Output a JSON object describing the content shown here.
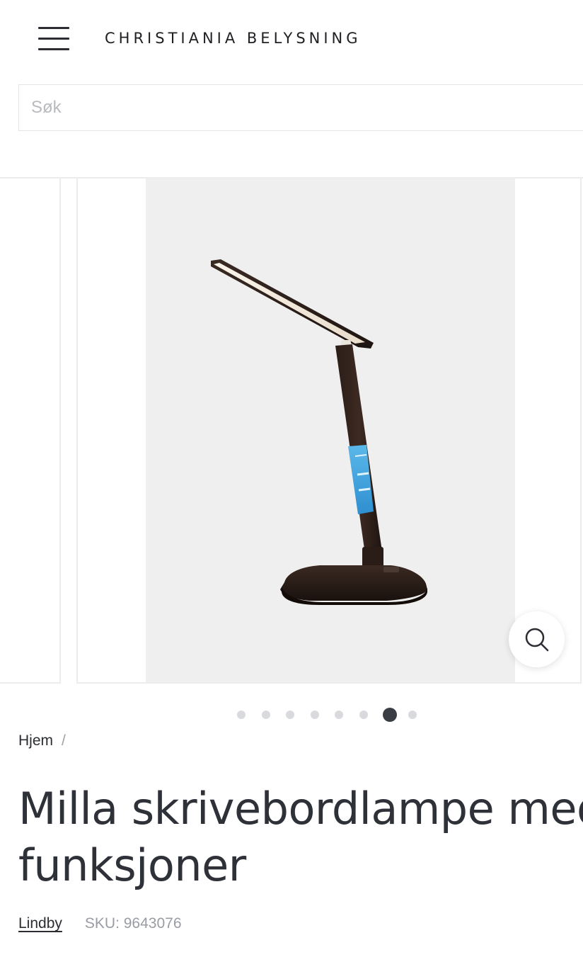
{
  "header": {
    "logo_text": "CHRISTIANIA BELYSNING",
    "menu_icon": "hamburger-menu-icon"
  },
  "search": {
    "placeholder": "Søk",
    "value": ""
  },
  "gallery": {
    "slide_count": 8,
    "active_index": 6,
    "zoom_icon": "magnifier-icon"
  },
  "breadcrumb": {
    "home_label": "Hjem",
    "separator": "/"
  },
  "product": {
    "title": "Milla skrivebordlampe med funksjoner",
    "brand": "Lindby",
    "sku_label": "SKU:",
    "sku_value": "9643076",
    "sku_text": "SKU: 9643076"
  },
  "colors": {
    "text_dark": "#2b2d33",
    "muted": "#9a9ca3",
    "dot_active": "#3b3d45",
    "dot_inactive": "#d9dadd",
    "photo_bg": "#efefef"
  }
}
